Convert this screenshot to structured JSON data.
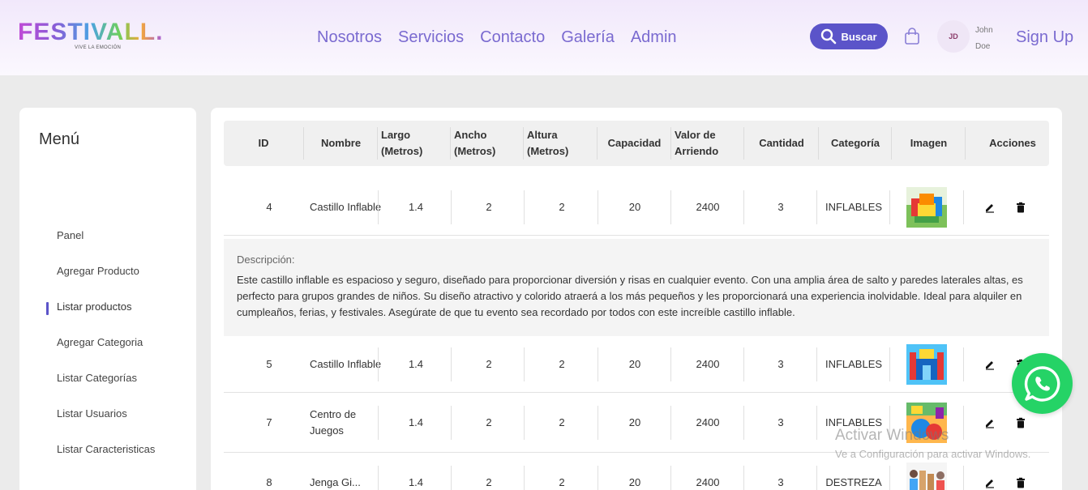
{
  "header": {
    "logo_text": "FESTIVALL.",
    "logo_tagline": "VIVE LA EMOCIÓN",
    "nav": [
      "Nosotros",
      "Servicios",
      "Contacto",
      "Galería",
      "Admin"
    ],
    "search_label": "Buscar",
    "avatar_initials": "JD",
    "user_first": "John",
    "user_last": "Doe",
    "signup_label": "Sign Up"
  },
  "sidebar": {
    "title": "Menú",
    "items": [
      "Panel",
      "Agregar Producto",
      "Listar productos",
      "Agregar Categoria",
      "Listar Categorías",
      "Listar Usuarios",
      "Listar Caracteristicas"
    ],
    "active_index": 2
  },
  "table": {
    "headers": {
      "id": "ID",
      "nombre": "Nombre",
      "largo": "Largo (Metros)",
      "ancho": "Ancho (Metros)",
      "altura": "Altura (Metros)",
      "capacidad": "Capacidad",
      "valor": "Valor de Arriendo",
      "cantidad": "Cantidad",
      "categoria": "Categoría",
      "imagen": "Imagen",
      "acciones": "Acciones"
    },
    "rows": [
      {
        "id": "4",
        "nombre": "Castillo Inflable",
        "largo": "1.4",
        "ancho": "2",
        "altura": "2",
        "capacidad": "20",
        "valor": "2400",
        "cantidad": "3",
        "categoria": "INFLABLES"
      },
      {
        "id": "5",
        "nombre": "Castillo Inflable",
        "largo": "1.4",
        "ancho": "2",
        "altura": "2",
        "capacidad": "20",
        "valor": "2400",
        "cantidad": "3",
        "categoria": "INFLABLES"
      },
      {
        "id": "7",
        "nombre": "Centro de Juegos",
        "largo": "1.4",
        "ancho": "2",
        "altura": "2",
        "capacidad": "20",
        "valor": "2400",
        "cantidad": "3",
        "categoria": "INFLABLES"
      },
      {
        "id": "8",
        "nombre": "Jenga Gi...",
        "largo": "1.4",
        "ancho": "2",
        "altura": "2",
        "capacidad": "20",
        "valor": "2400",
        "cantidad": "3",
        "categoria": "DESTREZA"
      }
    ],
    "description": {
      "label": "Descripción:",
      "text": "Este castillo inflable es espacioso y seguro, diseñado para proporcionar diversión y risas en cualquier evento. Con una amplia área de salto y paredes laterales altas, es perfecto para grupos grandes de niños. Su diseño atractivo y colorido atraerá a los más pequeños y les proporcionará una experiencia inolvidable. Ideal para alquiler en cumpleaños, ferias, y festivales. Asegúrate de que tu evento sea recordado por todos con este increíble castillo inflable."
    }
  },
  "overlays": {
    "watermark_title": "Activar Windows",
    "watermark_sub": "Ve a Configuración para activar Windows."
  },
  "colors": {
    "accent": "#5b54c9",
    "nav_text": "#7a6ad0",
    "whatsapp": "#25d366"
  }
}
